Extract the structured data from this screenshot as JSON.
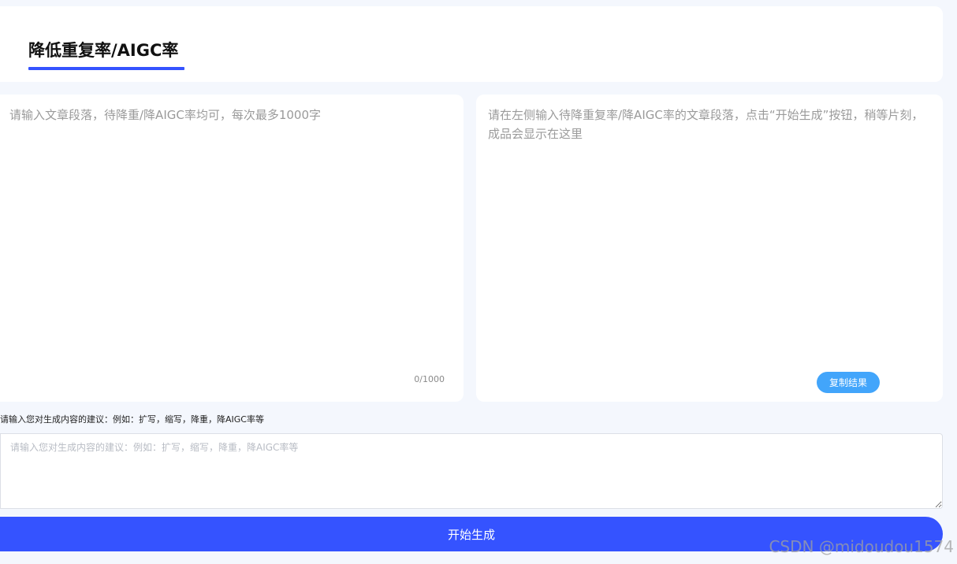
{
  "header": {
    "title": "降低重复率/AIGC率"
  },
  "input_panel": {
    "placeholder": "请输入文章段落，待降重/降AIGC率均可，每次最多1000字",
    "value": "",
    "char_count": "0/1000"
  },
  "output_panel": {
    "placeholder_text": "请在左侧输入待降重复率/降AIGC率的文章段落，点击“开始生成”按钮，稍等片刻，成品会显示在这里",
    "copy_button_label": "复制结果"
  },
  "suggestion": {
    "label": "请输入您对生成内容的建议：例如：扩写，缩写，降重，降AIGC率等",
    "placeholder": "请输入您对生成内容的建议：例如：扩写，缩写，降重，降AIGC率等",
    "value": ""
  },
  "actions": {
    "start_label": "开始生成"
  },
  "watermark": "CSDN @midoudou1574",
  "colors": {
    "page_background": "#f4f7fd",
    "primary": "#3553ff",
    "copy_button": "#42a5fb"
  }
}
